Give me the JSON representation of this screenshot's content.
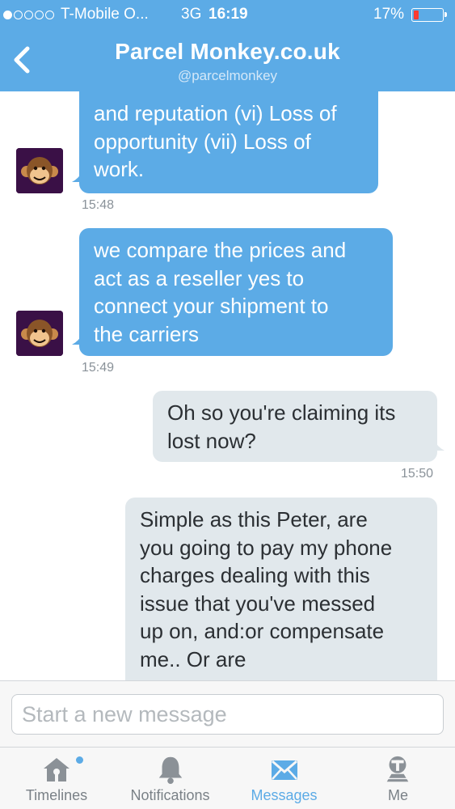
{
  "status_bar": {
    "carrier": "T-Mobile O...",
    "network": "3G",
    "time": "16:19",
    "battery_percent": "17%",
    "battery_level": 0.17,
    "signal_bars_filled": 1,
    "signal_bars_total": 5
  },
  "nav": {
    "back_icon": "chevron-left-icon",
    "title": "Parcel Monkey.co.uk",
    "subtitle": "@parcelmonkey"
  },
  "messages": [
    {
      "direction": "incoming",
      "lines": [
        "and reputation (vi) Loss of",
        "opportunity (vii) Loss of",
        "work."
      ],
      "time": "15:48"
    },
    {
      "direction": "incoming",
      "lines": [
        "we compare the prices and",
        "act as a reseller yes to",
        "connect your shipment to",
        "the carriers"
      ],
      "time": "15:49"
    },
    {
      "direction": "outgoing",
      "lines": [
        "Oh so you're claiming its",
        "lost now?"
      ],
      "time": "15:50"
    },
    {
      "direction": "outgoing",
      "lines": [
        "Simple as this Peter, are",
        "you going to pay my phone",
        "charges dealing with this",
        "issue that you've messed",
        "up on, and:or compensate",
        "me.. Or are"
      ],
      "time": ""
    }
  ],
  "composer": {
    "placeholder": "Start a new message"
  },
  "tabs": [
    {
      "label": "Timelines",
      "icon": "home-icon",
      "active": false,
      "has_badge": true
    },
    {
      "label": "Notifications",
      "icon": "bell-icon",
      "active": false,
      "has_badge": false
    },
    {
      "label": "Messages",
      "icon": "envelope-icon",
      "active": true,
      "has_badge": false
    },
    {
      "label": "Me",
      "icon": "profile-icon",
      "active": false,
      "has_badge": false
    }
  ],
  "colors": {
    "brand_blue": "#5cabe6",
    "incoming_bubble": "#5cabe6",
    "outgoing_bubble": "#e1e8ec",
    "battery_low": "#ff3b30"
  }
}
